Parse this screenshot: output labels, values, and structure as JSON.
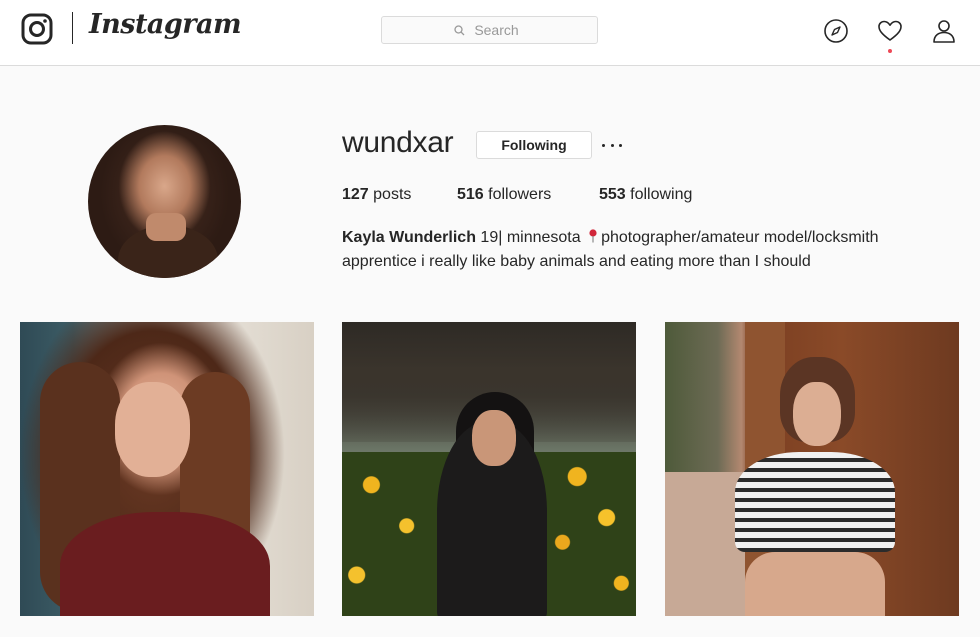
{
  "header": {
    "wordmark": "Instagram",
    "search": {
      "placeholder": "Search",
      "value": ""
    },
    "nav": {
      "explore_icon": "compass-icon",
      "activity_icon": "heart-icon",
      "profile_icon": "person-icon",
      "has_notification": true
    }
  },
  "profile": {
    "username": "wundxar",
    "follow_button_label": "Following",
    "more_options_icon": "ellipsis-icon",
    "stats": {
      "posts_count": "127",
      "posts_label": " posts",
      "followers_count": "516",
      "followers_label": " followers",
      "following_count": "553",
      "following_label": " following"
    },
    "bio": {
      "full_name": "Kayla Wunderlich",
      "text_before_pin": " 19| minnesota ",
      "pin_icon": "round-pushpin-icon",
      "text_after_pin": "photographer/amateur model/locksmith apprentice i really like baby animals and eating more than I should"
    }
  },
  "posts": [
    {
      "description": "portrait-woman-red-top"
    },
    {
      "description": "portrait-woman-yellow-flowers"
    },
    {
      "description": "portrait-woman-striped-shirt"
    }
  ],
  "colors": {
    "background": "#fafafa",
    "border": "#dbdbdb",
    "text": "#262626",
    "notification_dot": "#ed4956",
    "pin_red": "#d1263a"
  }
}
